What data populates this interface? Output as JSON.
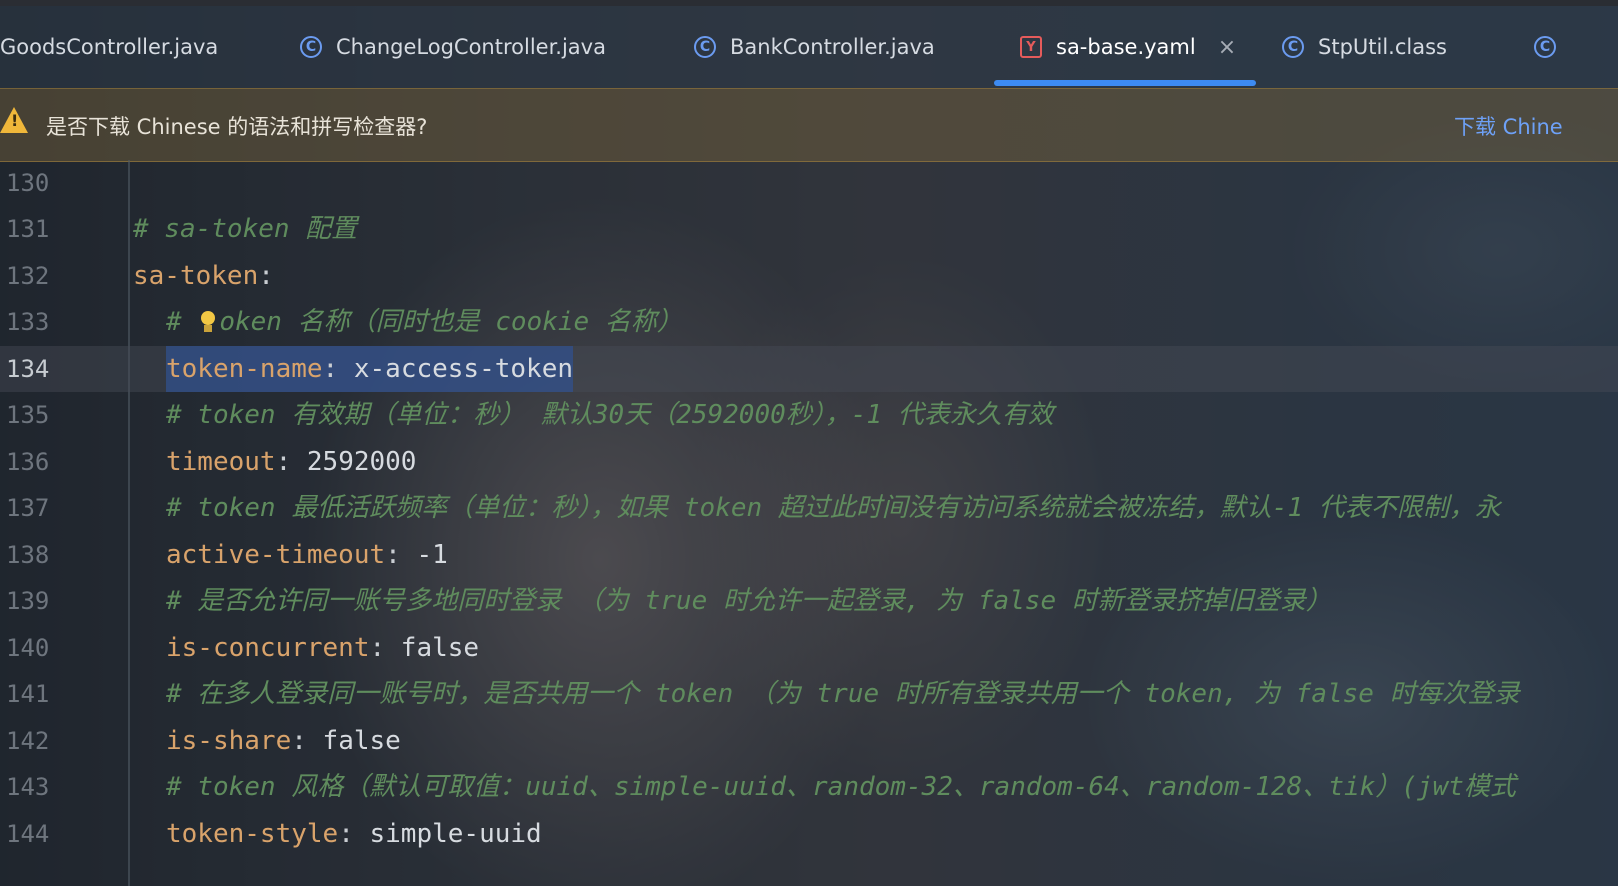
{
  "tabs": [
    {
      "label": "GoodsController.java",
      "icon": "class-icon",
      "active": false
    },
    {
      "label": "ChangeLogController.java",
      "icon": "class-icon",
      "active": false
    },
    {
      "label": "BankController.java",
      "icon": "class-icon",
      "active": false
    },
    {
      "label": "sa-base.yaml",
      "icon": "yaml-icon",
      "active": true,
      "close": "×"
    },
    {
      "label": "StpUtil.class",
      "icon": "class-icon",
      "active": false
    }
  ],
  "icons": {
    "class_glyph": "C",
    "yaml_glyph": "Y"
  },
  "banner": {
    "text": "是否下载 Chinese 的语法和拼写检查器?",
    "link": "下载 Chine",
    "icon": "warning-icon"
  },
  "editor": {
    "lines": [
      {
        "num": "130"
      },
      {
        "num": "131",
        "comment": "# sa-token 配置"
      },
      {
        "num": "132",
        "key": "sa-token",
        "punct": ":"
      },
      {
        "num": "133",
        "comment_pre": "# ",
        "comment_post": "oken 名称（同时也是 cookie 名称）"
      },
      {
        "num": "134",
        "key": "token-name",
        "punct": ":",
        "value": " x-access-token"
      },
      {
        "num": "135",
        "comment": "# token 有效期（单位：秒） 默认30天（2592000秒），-1 代表永久有效"
      },
      {
        "num": "136",
        "key": "timeout",
        "punct": ":",
        "value": " 2592000"
      },
      {
        "num": "137",
        "comment": "# token 最低活跃频率（单位：秒），如果 token 超过此时间没有访问系统就会被冻结，默认-1 代表不限制，永"
      },
      {
        "num": "138",
        "key": "active-timeout",
        "punct": ":",
        "value": " -1"
      },
      {
        "num": "139",
        "comment": "# 是否允许同一账号多地同时登录 （为 true 时允许一起登录, 为 false 时新登录挤掉旧登录）"
      },
      {
        "num": "140",
        "key": "is-concurrent",
        "punct": ":",
        "value": " false"
      },
      {
        "num": "141",
        "comment": "# 在多人登录同一账号时，是否共用一个 token （为 true 时所有登录共用一个 token, 为 false 时每次登录"
      },
      {
        "num": "142",
        "key": "is-share",
        "punct": ":",
        "value": " false"
      },
      {
        "num": "143",
        "comment": "# token 风格（默认可取值：uuid、simple-uuid、random-32、random-64、random-128、tik）(jwt模式"
      },
      {
        "num": "144",
        "key": "token-style",
        "punct": ":",
        "value": " simple-uuid"
      }
    ]
  }
}
